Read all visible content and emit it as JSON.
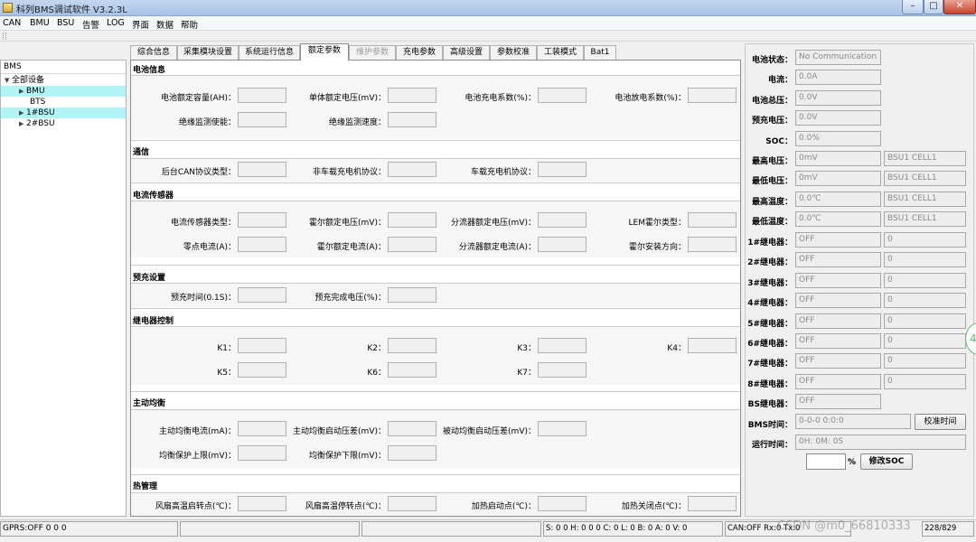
{
  "window": {
    "title": "科列BMS调试软件 V3.2.3L"
  },
  "menu": [
    "CAN",
    "BMU",
    "BSU",
    "告警",
    "LOG",
    "界面",
    "数据",
    "帮助"
  ],
  "tree": {
    "header": "BMS",
    "items": [
      {
        "label": "全部设备",
        "arrow": "▼"
      },
      {
        "label": "BMU",
        "arrow": "▶"
      },
      {
        "label": "BTS",
        "arrow": ""
      },
      {
        "label": "1#BSU",
        "arrow": "▶"
      },
      {
        "label": "2#BSU",
        "arrow": "▶"
      }
    ]
  },
  "tabs": [
    "综合信息",
    "采集模块设置",
    "系统运行信息",
    "额定参数",
    "维护参数",
    "充电参数",
    "高级设置",
    "参数校准",
    "工装模式",
    "Bat1"
  ],
  "sections": {
    "battery_info": {
      "title": "电池信息",
      "rated_capacity": "电池额定容量(AH)：",
      "cell_rated_voltage": "单体额定电压(mV)：",
      "charge_coef": "电池充电系数(%)：",
      "discharge_coef": "电池放电系数(%)：",
      "insulation_enable": "绝缘监测使能：",
      "insulation_speed": "绝缘监测速度："
    },
    "comm": {
      "title": "通信",
      "backend_can": "后台CAN协议类型：",
      "offboard_charger": "非车载充电机协议：",
      "onboard_charger": "车载充电机协议："
    },
    "current_sensor": {
      "title": "电流传感器",
      "sensor_type": "电流传感器类型：",
      "hall_rated_voltage": "霍尔额定电压(mV)：",
      "shunt_rated_voltage": "分流器额定电压(mV)：",
      "lem_hall_type": "LEM霍尔类型：",
      "zero_current": "零点电流(A)：",
      "hall_rated_current": "霍尔额定电流(A)：",
      "shunt_rated_current": "分流器额定电流(A)：",
      "hall_direction": "霍尔安装方向："
    },
    "precharge": {
      "title": "预充设置",
      "time": "预充时间(0.1S)：",
      "done_voltage": "预充完成电压(%)："
    },
    "relay": {
      "title": "继电器控制",
      "k1": "K1：",
      "k2": "K2：",
      "k3": "K3：",
      "k4": "K4：",
      "k5": "K5：",
      "k6": "K6：",
      "k7": "K7："
    },
    "active_balance": {
      "title": "主动均衡",
      "current": "主动均衡电流(mA)：",
      "start_diff": "主动均衡启动压差(mV)：",
      "passive_start_diff": "被动均衡启动压差(mV)：",
      "upper_limit": "均衡保护上限(mV)：",
      "lower_limit": "均衡保护下限(mV)："
    },
    "thermal": {
      "title": "热管理",
      "fan_start": "风扇高温启转点(℃)：",
      "fan_stop": "风扇高温停转点(℃)：",
      "heat_start": "加热启动点(℃)：",
      "heat_stop": "加热关闭点(℃)："
    }
  },
  "status": {
    "battery_state": {
      "label": "电池状态：",
      "value": "No Communication"
    },
    "current": {
      "label": "电流：",
      "value": "0.0A"
    },
    "total_voltage": {
      "label": "电池总压：",
      "value": "0.0V"
    },
    "precharge_voltage": {
      "label": "预充电压：",
      "value": "0.0V"
    },
    "soc": {
      "label": "SOC：",
      "value": "0.0%"
    },
    "max_voltage": {
      "label": "最高电压：",
      "value": "0mV",
      "cell": "BSU1 CELL1"
    },
    "min_voltage": {
      "label": "最低电压：",
      "value": "0mV",
      "cell": "BSU1 CELL1"
    },
    "max_temp": {
      "label": "最高温度：",
      "value": "0.0℃",
      "cell": "BSU1 CELL1"
    },
    "min_temp": {
      "label": "最低温度：",
      "value": "0.0℃",
      "cell": "BSU1 CELL1"
    },
    "relays": [
      {
        "label": "1#继电器：",
        "state": "OFF",
        "count": "0"
      },
      {
        "label": "2#继电器：",
        "state": "OFF",
        "count": "0"
      },
      {
        "label": "3#继电器：",
        "state": "OFF",
        "count": "0"
      },
      {
        "label": "4#继电器：",
        "state": "OFF",
        "count": "0"
      },
      {
        "label": "5#继电器：",
        "state": "OFF",
        "count": "0"
      },
      {
        "label": "6#继电器：",
        "state": "OFF",
        "count": "0"
      },
      {
        "label": "7#继电器：",
        "state": "OFF",
        "count": "0"
      },
      {
        "label": "8#继电器：",
        "state": "OFF",
        "count": "0"
      }
    ],
    "bs_relay": {
      "label": "BS继电器：",
      "state": "OFF"
    },
    "bms_time": {
      "label": "BMS时间：",
      "value": "0-0-0 0:0:0",
      "button": "校准时间"
    },
    "run_time": {
      "label": "运行时间：",
      "value": "0H: 0M: 0S"
    },
    "soc_edit": {
      "unit": "%",
      "button": "修改SOC"
    }
  },
  "statusbar": {
    "gprs": "GPRS:OFF  0  0  0",
    "counters": "S:  0 0 H:  0 0 0 C:  0 L:  0 B:  0 A:  0 V:  0",
    "can": "CAN:OFF  Rx:0  Tx:0",
    "extra": "228/829"
  },
  "watermark": "CSDN @m0_66810333"
}
